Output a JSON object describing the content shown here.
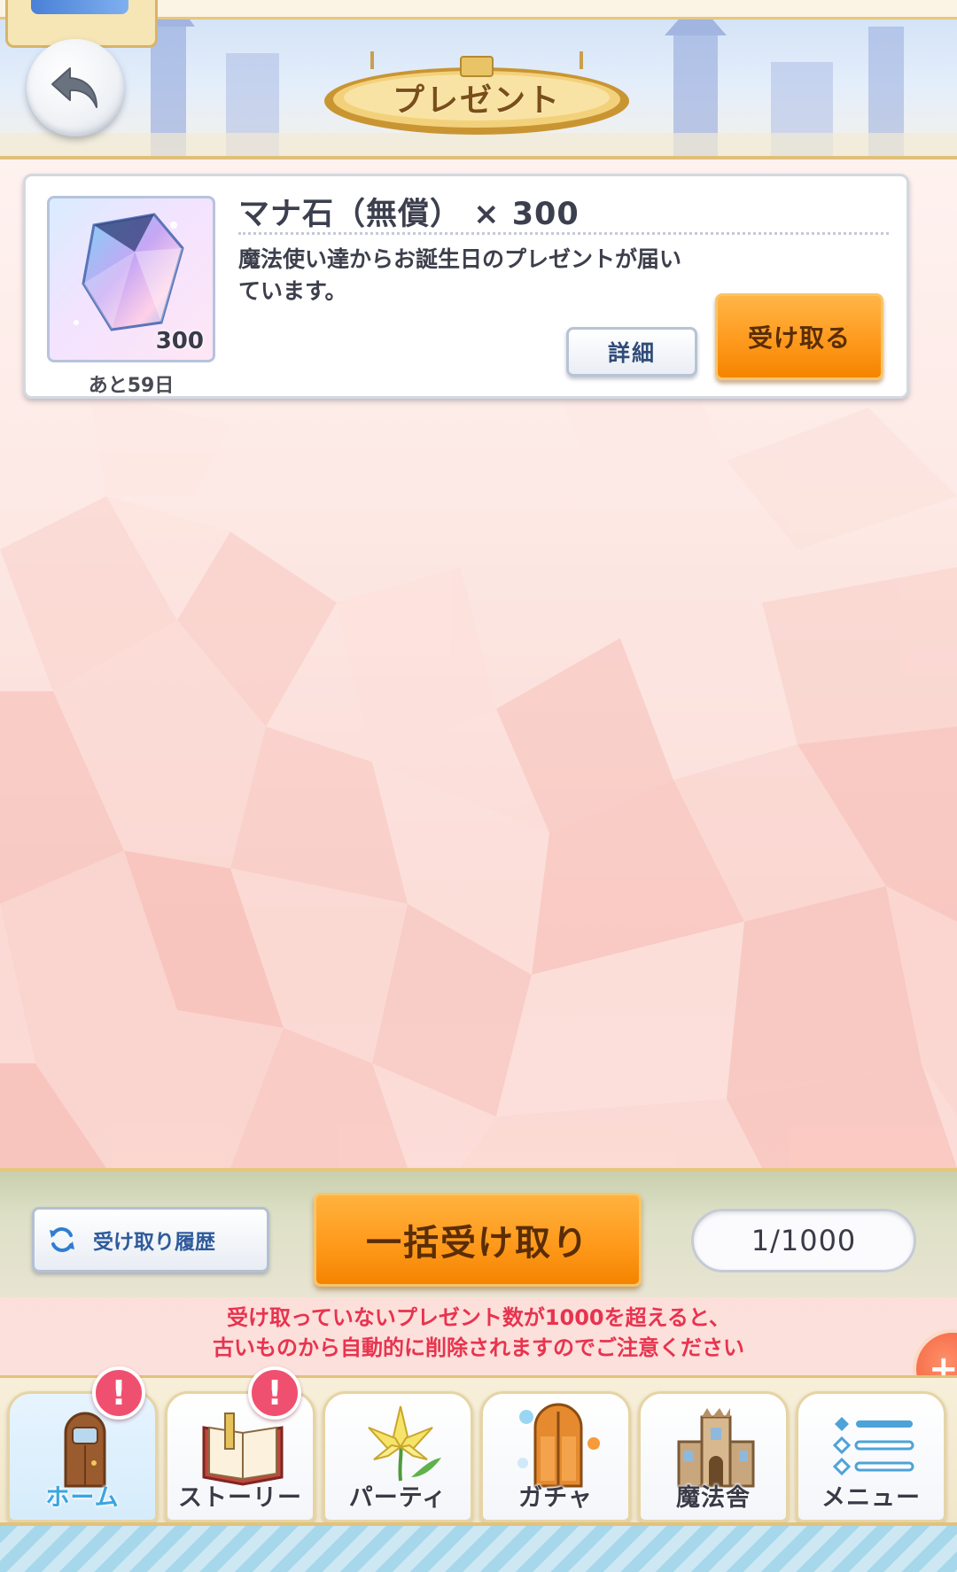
{
  "header": {
    "title": "プレゼント",
    "back_icon": "back-arrow-icon"
  },
  "present": {
    "item_name": "マナ石（無償） × 300",
    "item_count": "300",
    "expire": "あと59日",
    "description": "魔法使い達からお誕生日のプレゼントが届いています。",
    "detail_label": "詳細",
    "receive_label": "受け取る",
    "item_icon": "mana-crystal-icon"
  },
  "actions": {
    "history_label": "受け取り履歴",
    "history_icon": "refresh-icon",
    "bulk_label": "一括受け取り",
    "count": "1/1000",
    "warning_line1": "受け取っていないプレゼント数が1000を超えると、",
    "warning_line2": "古いものから自動的に削除されますのでご注意ください",
    "plus_icon": "plus-icon"
  },
  "nav": {
    "items": [
      {
        "label": "ホーム",
        "icon": "door-icon",
        "alert": "!"
      },
      {
        "label": "ストーリー",
        "icon": "book-icon",
        "alert": "!"
      },
      {
        "label": "パーティ",
        "icon": "lily-icon"
      },
      {
        "label": "ガチャ",
        "icon": "gacha-door-icon"
      },
      {
        "label": "魔法舎",
        "icon": "castle-icon"
      },
      {
        "label": "メニュー",
        "icon": "menu-list-icon"
      }
    ]
  },
  "colors": {
    "accent_orange": "#ff9a1e",
    "warning_red": "#e8334f",
    "gold_border": "#e0c079",
    "active_nav": "#3aa6e0"
  }
}
